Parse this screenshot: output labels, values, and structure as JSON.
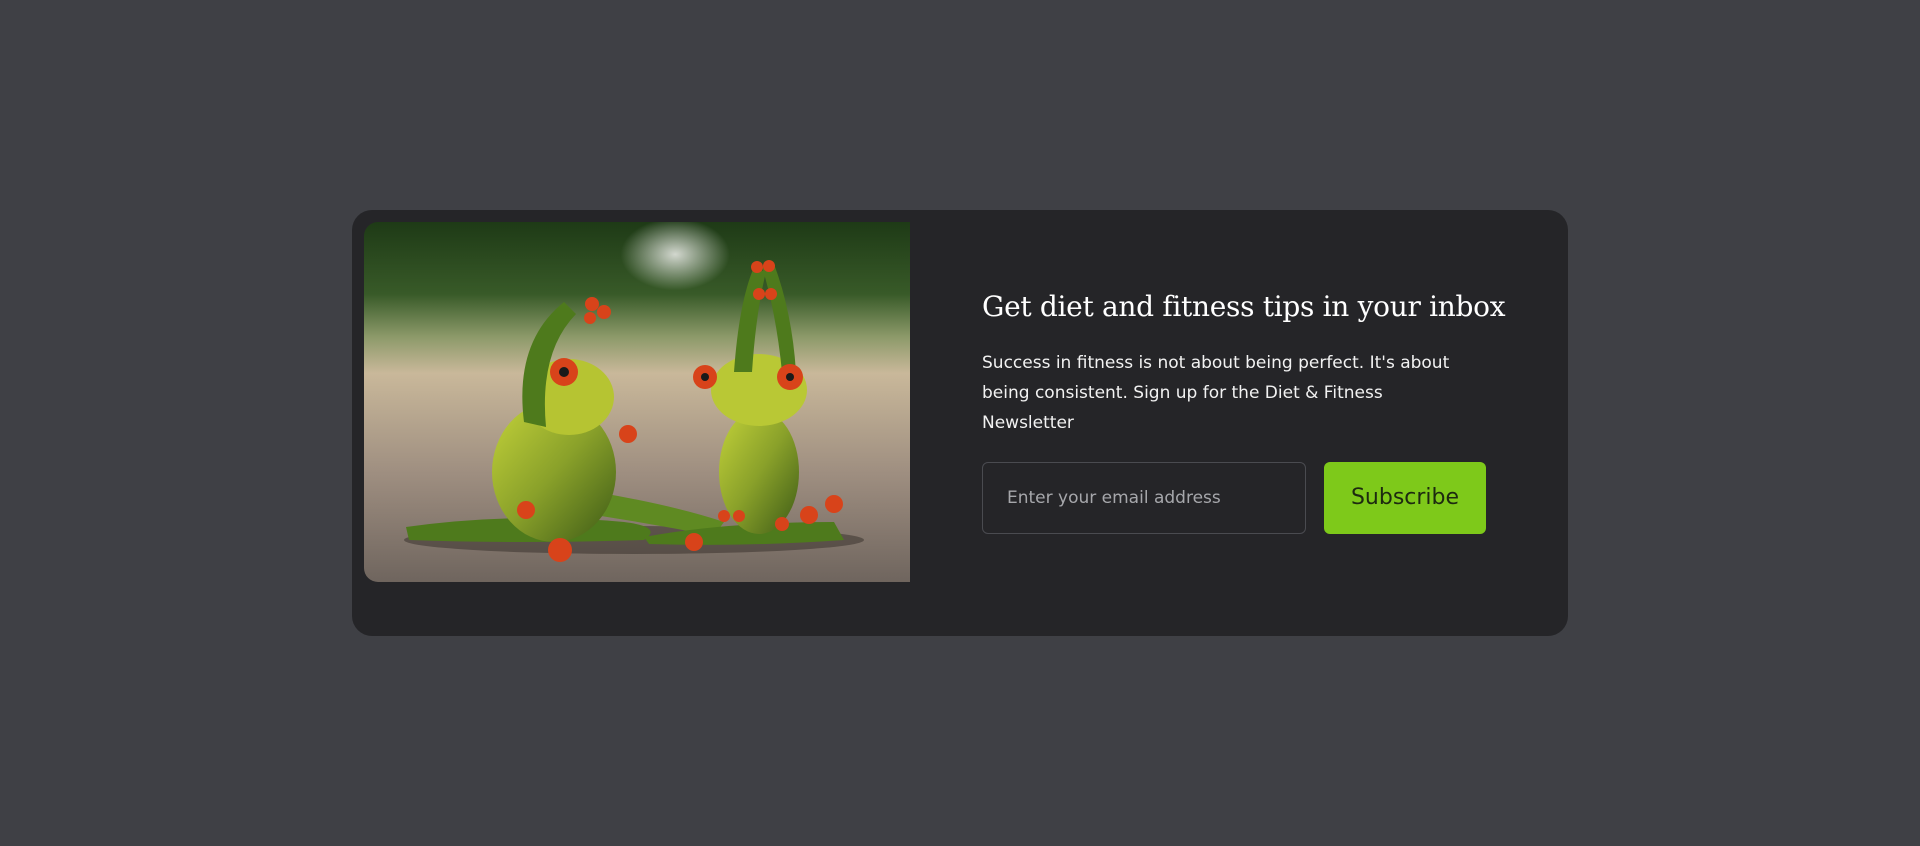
{
  "newsletter": {
    "title": "Get diet and fitness tips in your inbox",
    "description": "Success in fitness is not about being perfect. It's about being consistent. Sign up for the Diet & Fitness Newsletter",
    "email_placeholder": "Enter your email address",
    "subscribe_label": "Subscribe",
    "image_subject": "two frog figurines doing yoga stretches"
  },
  "colors": {
    "page_background": "#3f4045",
    "card_background": "#252528",
    "accent": "#7ec91a",
    "input_border": "#4a4b50"
  }
}
